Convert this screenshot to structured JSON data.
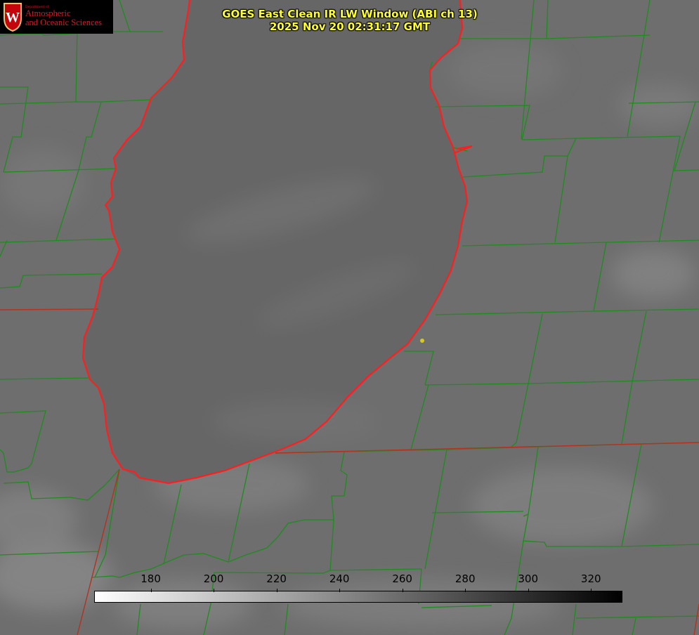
{
  "header": {
    "title": "GOES East Clean IR LW Window (ABI ch 13)",
    "timestamp": "2025 Nov 20 02:31:17 GMT"
  },
  "logo": {
    "department": "Department of",
    "line1": "Atmospheric",
    "line2": "and Oceanic Sciences",
    "crest_letter": "W",
    "icon": "uw-crest-icon"
  },
  "colorbar": {
    "ticks": [
      "180",
      "200",
      "220",
      "240",
      "260",
      "280",
      "300",
      "320"
    ],
    "range": [
      162,
      330
    ],
    "colors": {
      "low": "#ffffff",
      "high": "#000000"
    }
  },
  "map": {
    "colors": {
      "land": "#6e6e6e",
      "lake": "#666666",
      "county_lines": "#1e8c1e",
      "state_lines": "#b4321e",
      "coastline": "#ff1e1e",
      "marker": "#d7c81e"
    }
  }
}
